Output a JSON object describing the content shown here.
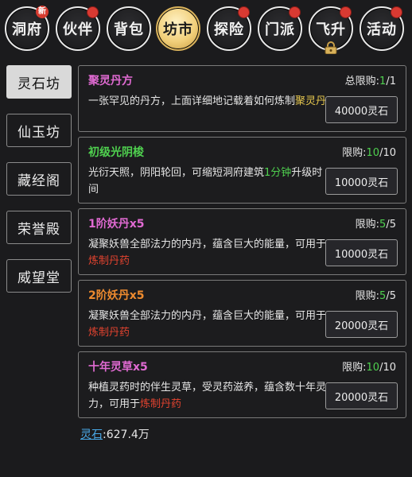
{
  "nav": {
    "tabs": [
      {
        "label": "洞府",
        "badge": "新"
      },
      {
        "label": "伙伴"
      },
      {
        "label": "背包"
      },
      {
        "label": "坊市",
        "active": true
      },
      {
        "label": "探险"
      },
      {
        "label": "门派"
      },
      {
        "label": "飞升"
      },
      {
        "label": "活动"
      }
    ]
  },
  "sidebar": {
    "items": [
      {
        "label": "灵石坊"
      },
      {
        "label": "仙玉坊"
      },
      {
        "label": "藏经阁"
      },
      {
        "label": "荣誉殿"
      },
      {
        "label": "威望堂"
      }
    ]
  },
  "shop": {
    "items": [
      {
        "name": "聚灵丹方",
        "name_color": "#e06ad2",
        "limit_label": "总限购:",
        "limit_current": "1",
        "limit_sep": "/",
        "limit_max": "1",
        "desc_a": "一张罕见的丹方，上面详细地记载着如何炼制",
        "desc_hl": "聚灵丹",
        "desc_b": "",
        "price": "40000灵石"
      },
      {
        "name": "初级光阴梭",
        "name_color": "#4fd14f",
        "limit_label": "限购:",
        "limit_current": "10",
        "limit_sep": "/",
        "limit_max": "10",
        "desc_a": "光衍天照，阴阳轮回，可缩短洞府建筑",
        "desc_hl": "1分钟",
        "desc_b": "升级时间",
        "price": "10000灵石"
      },
      {
        "name": "1阶妖丹x5",
        "name_color": "#e06ad2",
        "limit_label": "限购:",
        "limit_current": "5",
        "limit_sep": "/",
        "limit_max": "5",
        "desc_a": "凝聚妖兽全部法力的内丹，蕴含巨大的能量，可用于",
        "desc_hl": "炼制丹药",
        "desc_b": "",
        "price": "10000灵石"
      },
      {
        "name": "2阶妖丹x5",
        "name_color": "#ee8b2f",
        "limit_label": "限购:",
        "limit_current": "5",
        "limit_sep": "/",
        "limit_max": "5",
        "desc_a": "凝聚妖兽全部法力的内丹，蕴含巨大的能量，可用于",
        "desc_hl": "炼制丹药",
        "desc_b": "",
        "price": "20000灵石"
      },
      {
        "name": "十年灵草x5",
        "name_color": "#e06ad2",
        "limit_label": "限购:",
        "limit_current": "10",
        "limit_sep": "/",
        "limit_max": "10",
        "desc_a": "种植灵药时的伴生灵草，受灵药滋养，蕴含数十年灵力，可用于",
        "desc_hl": "炼制丹药",
        "desc_b": "",
        "price": "20000灵石"
      }
    ]
  },
  "footer": {
    "currency_label": "灵石",
    "separator": ":",
    "amount": "627.4万"
  },
  "colors": {
    "active_tab": "#f1cf7a",
    "limit_current": "#4fd14f",
    "highlight_red": "#e2432f",
    "highlight_yellow": "#e7c84f",
    "currency_link": "#49a8e6"
  }
}
